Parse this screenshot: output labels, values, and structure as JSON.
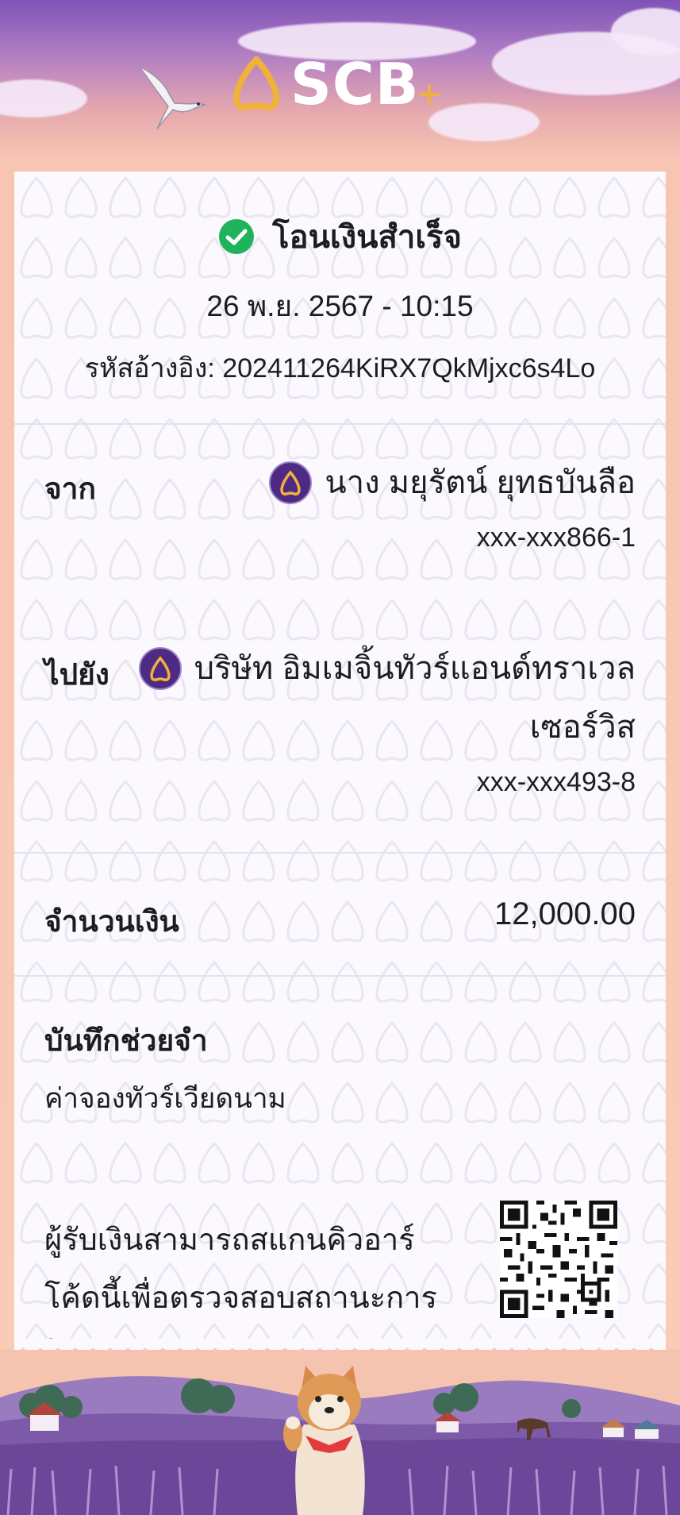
{
  "app": {
    "brand": "SCB",
    "brand_plus": "+"
  },
  "status": {
    "icon": "check-circle-icon",
    "text": "โอนเงินสำเร็จ",
    "color": "#1fb35a"
  },
  "datetime": "26 พ.ย. 2567 - 10:15",
  "reference": {
    "label": "รหัสอ้างอิง:",
    "value": "202411264KiRX7QkMjxc6s4Lo"
  },
  "from": {
    "label": "จาก",
    "name": "นาง มยุรัตน์ ยุทธบันลือ",
    "account": "xxx-xxx866-1",
    "bank_icon": "scb-bank-icon"
  },
  "to": {
    "label": "ไปยัง",
    "name_line1": "บริษัท อิมเมจิ้นทัวร์แอนด์ทราเวล",
    "name_line2": "เซอร์วิส",
    "account": "xxx-xxx493-8",
    "bank_icon": "scb-bank-icon"
  },
  "amount": {
    "label": "จำนวนเงิน",
    "value": "12,000.00"
  },
  "memo": {
    "label": "บันทึกช่วยจำ",
    "text": "ค่าจองทัวร์เวียดนาม"
  },
  "qr": {
    "note_line1": "ผู้รับเงินสามารถสแกนคิวอาร์",
    "note_line2": "โค้ดนี้เพื่อตรวจสอบสถานะการ",
    "note_line3": "โอนเงิน",
    "icon": "qr-code-icon"
  },
  "colors": {
    "brand_purple": "#4e2a84",
    "brand_gold": "#f0b23a",
    "success_green": "#1fb35a"
  }
}
